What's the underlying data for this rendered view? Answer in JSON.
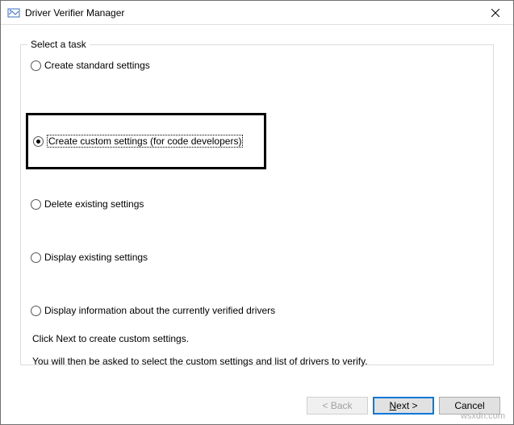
{
  "window": {
    "title": "Driver Verifier Manager"
  },
  "group": {
    "legend": "Select a task"
  },
  "options": {
    "create_standard": "Create standard settings",
    "create_custom": "Create custom settings (for code developers)",
    "delete_existing": "Delete existing settings",
    "display_existing": "Display existing settings",
    "display_info": "Display information about the currently verified drivers"
  },
  "info": {
    "line1": "Click Next to create custom settings.",
    "line2": "You will then be asked to select the custom settings and list of drivers to verify."
  },
  "buttons": {
    "back": "< Back",
    "cancel": "Cancel"
  },
  "watermark": "wsxdn.com"
}
